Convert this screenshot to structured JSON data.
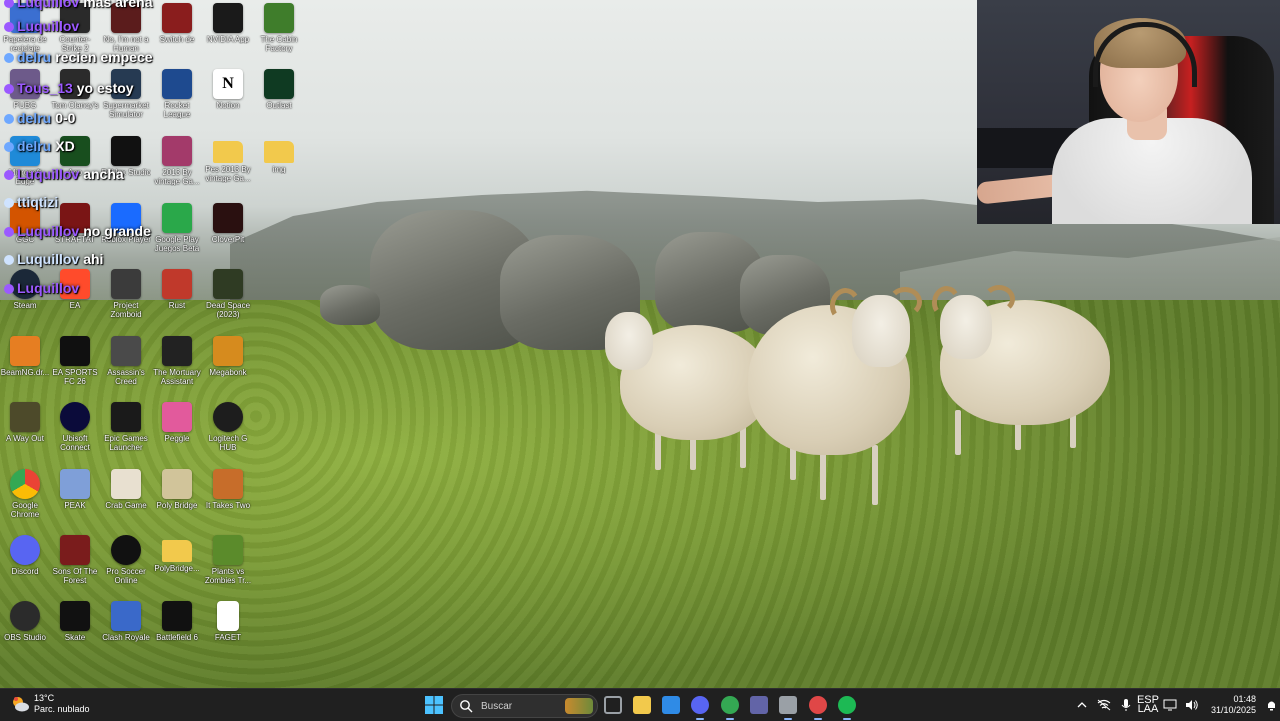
{
  "desktop": {
    "icons": [
      {
        "label": "Papelera de reciclaje",
        "icon": "recycle-bin-icon",
        "color": "#3b6fd1"
      },
      {
        "label": "Counter-Strike 2",
        "icon": "counter-strike-icon",
        "color": "#2a2a2a"
      },
      {
        "label": "No, I'm not a Human",
        "icon": "game-icon",
        "color": "#5b1c1c"
      },
      {
        "label": "Switch de",
        "icon": "game-icon",
        "color": "#8a1d1d"
      },
      {
        "label": "NVIDIA App",
        "icon": "nvidia-icon",
        "color": "#1a1a1a"
      },
      {
        "label": "The Cabin Factory",
        "icon": "frog-icon",
        "color": "#3f7d2b"
      },
      {
        "label": "PUBG",
        "icon": "game-icon",
        "color": "#6d5a8a"
      },
      {
        "label": "Tom Clancy's",
        "icon": "game-icon",
        "color": "#2b2b2b"
      },
      {
        "label": "Supermarket Simulator",
        "icon": "game-icon",
        "color": "#263a52"
      },
      {
        "label": "Rocket League",
        "icon": "rocket-league-icon",
        "color": "#1e4a8f"
      },
      {
        "label": "Notion",
        "icon": "notion-icon",
        "color": "#ffffff"
      },
      {
        "label": "Outlast",
        "icon": "game-icon",
        "color": "#0f3a22"
      },
      {
        "label": "Microsoft Edge",
        "icon": "edge-icon",
        "color": "#1f8ad8"
      },
      {
        "label": "App",
        "icon": "app-icon",
        "color": "#184e1e"
      },
      {
        "label": "Roblox Studio",
        "icon": "roblox-studio-icon",
        "color": "#111111"
      },
      {
        "label": "2013 By vintage Ga...",
        "icon": "archive-icon",
        "color": "#a33a6a"
      },
      {
        "label": "Pes 2013 By vintage Ga...",
        "icon": "folder-icon",
        "color": "#f2c94c"
      },
      {
        "label": "img",
        "icon": "folder-icon",
        "color": "#f2c94c"
      },
      {
        "label": "GGC",
        "icon": "game-icon",
        "color": "#d35400"
      },
      {
        "label": "STRAFTAT",
        "icon": "game-icon",
        "color": "#7a1515"
      },
      {
        "label": "Roblox Player",
        "icon": "roblox-icon",
        "color": "#1a6bff"
      },
      {
        "label": "Google Play Juegos Beta",
        "icon": "google-play-icon",
        "color": "#2aa84a"
      },
      {
        "label": "CloverPit",
        "icon": "game-icon",
        "color": "#2a1010"
      },
      {
        "label": "Steam",
        "icon": "steam-icon",
        "color": "#1b2838"
      },
      {
        "label": "EA",
        "icon": "ea-icon",
        "color": "#ff4b2b"
      },
      {
        "label": "Project Zomboid",
        "icon": "game-icon",
        "color": "#3b3b3b"
      },
      {
        "label": "Rust",
        "icon": "rust-icon",
        "color": "#c0392b"
      },
      {
        "label": "Dead Space (2023)",
        "icon": "game-icon",
        "color": "#2f3b23"
      },
      {
        "label": "BeamNG.dr...",
        "icon": "game-icon",
        "color": "#e67e22"
      },
      {
        "label": "EA SPORTS FC 26",
        "icon": "fc-icon",
        "color": "#101010"
      },
      {
        "label": "Assassin's Creed",
        "icon": "game-icon",
        "color": "#4a4a4a"
      },
      {
        "label": "The Mortuary Assistant",
        "icon": "game-icon",
        "color": "#222222"
      },
      {
        "label": "Megabonk",
        "icon": "game-icon",
        "color": "#d68b1e"
      },
      {
        "label": "A Way Out",
        "icon": "game-icon",
        "color": "#4d4a2a"
      },
      {
        "label": "Ubisoft Connect",
        "icon": "ubisoft-icon",
        "color": "#0b0b3a"
      },
      {
        "label": "Epic Games Launcher",
        "icon": "epic-icon",
        "color": "#1a1a1a"
      },
      {
        "label": "Peggle",
        "icon": "game-icon",
        "color": "#e25a9c"
      },
      {
        "label": "Logitech G HUB",
        "icon": "logitech-icon",
        "color": "#1d1d1d"
      },
      {
        "label": "Google Chrome",
        "icon": "chrome-icon",
        "color": "#ffffff"
      },
      {
        "label": "PEAK",
        "icon": "game-icon",
        "color": "#7f9fd8"
      },
      {
        "label": "Crab Game",
        "icon": "game-icon",
        "color": "#e8e0d0"
      },
      {
        "label": "Poly Bridge",
        "icon": "game-icon",
        "color": "#d1c49a"
      },
      {
        "label": "It Takes Two",
        "icon": "game-icon",
        "color": "#c76d2a"
      },
      {
        "label": "Discord",
        "icon": "discord-icon",
        "color": "#5865f2"
      },
      {
        "label": "Sons Of The Forest",
        "icon": "game-icon",
        "color": "#7a1c1c"
      },
      {
        "label": "Pro Soccer Online",
        "icon": "soccer-icon",
        "color": "#111111"
      },
      {
        "label": "PolyBridge...",
        "icon": "folder-icon",
        "color": "#f2c94c"
      },
      {
        "label": "Plants vs Zombies Tr...",
        "icon": "game-icon",
        "color": "#5b8b2b"
      },
      {
        "label": "OBS Studio",
        "icon": "obs-icon",
        "color": "#2b2b2b"
      },
      {
        "label": "Skate",
        "icon": "skate-icon",
        "color": "#111111"
      },
      {
        "label": "Clash Royale",
        "icon": "game-icon",
        "color": "#3a69c9"
      },
      {
        "label": "Battlefield 6",
        "icon": "battlefield-icon",
        "color": "#111111"
      },
      {
        "label": "FAGET",
        "icon": "file-icon",
        "color": "#ffffff"
      }
    ]
  },
  "chat": {
    "messages": [
      {
        "user": "Luquillov",
        "text": "mas arena",
        "color": "#9b59ff"
      },
      {
        "user": "Luquillov",
        "text": "",
        "color": "#9b59ff"
      },
      {
        "user": "delru",
        "text": "recien empece",
        "color": "#6ea8ff"
      },
      {
        "user": "Tous_13",
        "text": "yo estoy",
        "color": "#9b59ff"
      },
      {
        "user": "delru",
        "text": "0-0",
        "color": "#6ea8ff"
      },
      {
        "user": "delru",
        "text": "XD",
        "color": "#6ea8ff"
      },
      {
        "user": "Luquillov",
        "text": "ancha",
        "color": "#9b59ff"
      },
      {
        "user": "ttiqtizi",
        "text": "",
        "color": "#cfe3ff"
      },
      {
        "user": "Luquillov",
        "text": "no grande",
        "color": "#9b59ff"
      },
      {
        "user": "Luquillov",
        "text": "ahi",
        "color": "#cfe3ff"
      },
      {
        "user": "Luquillov",
        "text": "",
        "color": "#9b59ff"
      }
    ]
  },
  "taskbar": {
    "weather": {
      "temp": "13°C",
      "desc": "Parc. nublado"
    },
    "search": {
      "placeholder": "Buscar"
    },
    "apps": [
      {
        "name": "task-view-icon",
        "color": "#9aa0a6"
      },
      {
        "name": "file-explorer-icon",
        "color": "#f2c94c"
      },
      {
        "name": "microsoft-store-icon",
        "color": "#2f8be6"
      },
      {
        "name": "discord-icon",
        "color": "#5865f2"
      },
      {
        "name": "chrome-icon",
        "color": "#34a853"
      },
      {
        "name": "teams-icon",
        "color": "#6264a7"
      },
      {
        "name": "settings-icon",
        "color": "#9aa0a6"
      },
      {
        "name": "obs-icon",
        "color": "#e04747"
      },
      {
        "name": "spotify-icon",
        "color": "#1db954"
      }
    ],
    "lang": {
      "line1": "ESP",
      "line2": "LAA"
    },
    "clock": {
      "time": "01:48",
      "date": "31/10/2025"
    }
  }
}
